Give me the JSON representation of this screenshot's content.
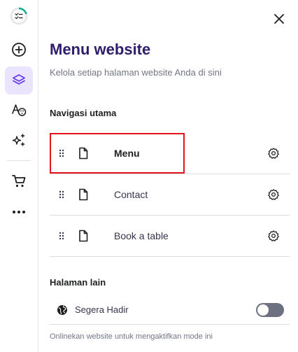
{
  "rail": {
    "items": [
      {
        "icon": "checklist-progress-icon"
      },
      {
        "icon": "plus-circle-icon"
      },
      {
        "icon": "layers-icon",
        "active": true
      },
      {
        "icon": "palette-icon"
      },
      {
        "icon": "sparkles-icon"
      },
      {
        "icon": "cart-icon"
      },
      {
        "icon": "more-icon"
      }
    ]
  },
  "panel": {
    "title": "Menu website",
    "subtitle": "Kelola setiap halaman website Anda di sini",
    "main_nav_label": "Navigasi utama",
    "pages": [
      {
        "label": "Menu",
        "selected": true
      },
      {
        "label": "Contact"
      },
      {
        "label": "Book a table"
      }
    ],
    "other_label": "Halaman lain",
    "coming_soon": {
      "label": "Segera Hadir",
      "enabled": false
    },
    "footer_note": "Onlinekan website untuk mengaktifkan mode ini"
  },
  "colors": {
    "accent": "#673de6",
    "active_bg": "#ebe4ff",
    "title": "#2f1c6a",
    "highlight": "#e3141b",
    "progress": "#00b090"
  }
}
